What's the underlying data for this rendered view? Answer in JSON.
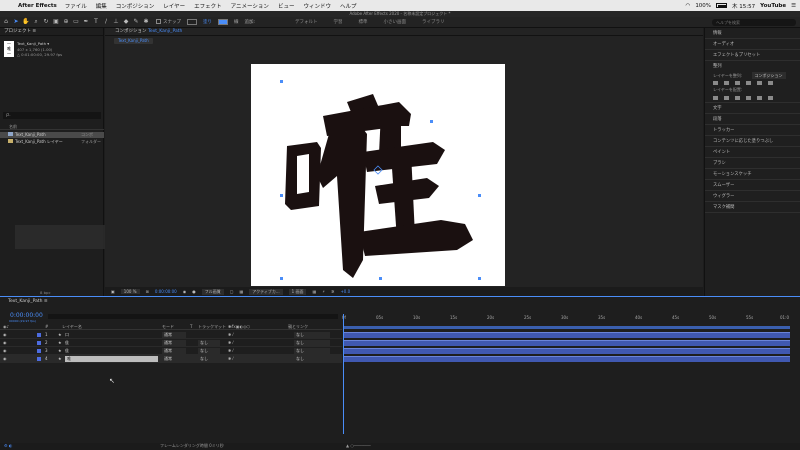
{
  "menubar": {
    "app": "After Effects",
    "items": [
      "ファイル",
      "編集",
      "コンポジション",
      "レイヤー",
      "エフェクト",
      "アニメーション",
      "ビュー",
      "ウィンドウ",
      "ヘルプ"
    ],
    "battery": "100%",
    "clock": "木 15:57",
    "youtube": "YouTube"
  },
  "title": "Adobe After Effects 2020 - 名称未設定プロジェクト *",
  "toolbar": {
    "snap_label": "スナップ",
    "fill_label": "塗り",
    "stroke_label": "線",
    "add_label": "追加:",
    "workspaces": [
      "デフォルト",
      "学習",
      "標準",
      "小さい画面",
      "ライブラリ"
    ],
    "search_placeholder": "ヘルプを検索"
  },
  "project": {
    "tab": "プロジェクト ≡",
    "thumb_text": "一\n唯\n一",
    "comp_name": "Text_Kanji_Path ▾",
    "info1": "407 x 1,760 (1.00)",
    "info2": "△ 0:01:00:00, 29.97 fps",
    "search_placeholder": "ρ.",
    "header_name": "名前",
    "rows": [
      {
        "name": "Text_Kanji_Path",
        "type": "コンポ"
      },
      {
        "name": "Text_Kanji_Path レイヤー",
        "type": "フォルダー"
      }
    ],
    "footer_bpc": "8 bpc"
  },
  "comp": {
    "tab": "コンポジション",
    "tab_name": "Text_Kanji_Path",
    "breadcrumb": "Text_Kanji_Path",
    "kanji": "唯",
    "footer": {
      "zoom": "100 %",
      "time": "0:00:00:00",
      "resolution": "フル画質",
      "camera": "アクティブカ...",
      "views": "1 画面",
      "offset": "+0.0"
    }
  },
  "right_panel": {
    "sections": [
      "情報",
      "オーディオ",
      "エフェクト＆プリセット"
    ],
    "align_title": "整列",
    "align_layers_to": "レイヤーを整列:",
    "align_target": "コンポジション",
    "distribute_label": "レイヤーを配置:",
    "more": [
      "文字",
      "段落",
      "トラッカー",
      "コンテンツに応じた塗りつぶし",
      "ペイント",
      "ブラシ",
      "モーションスケッチ",
      "スムーザー",
      "ウィグラー",
      "マスク補間"
    ]
  },
  "timeline": {
    "tab": "Text_Kanji_Path ≡",
    "timecode": "0:00:00:00",
    "timecode_sub": "00000 (29.97 fps)",
    "col_layer_name": "レイヤー名",
    "col_mode": "モード",
    "col_t": "T",
    "col_track": "トラックマット",
    "col_parent": "親とリンク",
    "layers": [
      {
        "num": "1",
        "name": "口",
        "mode": "通常",
        "track": "",
        "parent": "なし"
      },
      {
        "num": "2",
        "name": "隹",
        "mode": "通常",
        "track": "なし",
        "parent": "なし"
      },
      {
        "num": "3",
        "name": "隹",
        "mode": "通常",
        "track": "なし",
        "parent": "なし"
      },
      {
        "num": "4",
        "name": "唯",
        "mode": "通常",
        "track": "なし",
        "parent": "なし"
      }
    ],
    "ruler": [
      "0f",
      "05s",
      "10s",
      "15s",
      "20s",
      "25s",
      "30s",
      "35s",
      "40s",
      "45s",
      "50s",
      "55s",
      "01:0"
    ],
    "footer": "フレームレンダリング時間 0ミリ秒"
  }
}
